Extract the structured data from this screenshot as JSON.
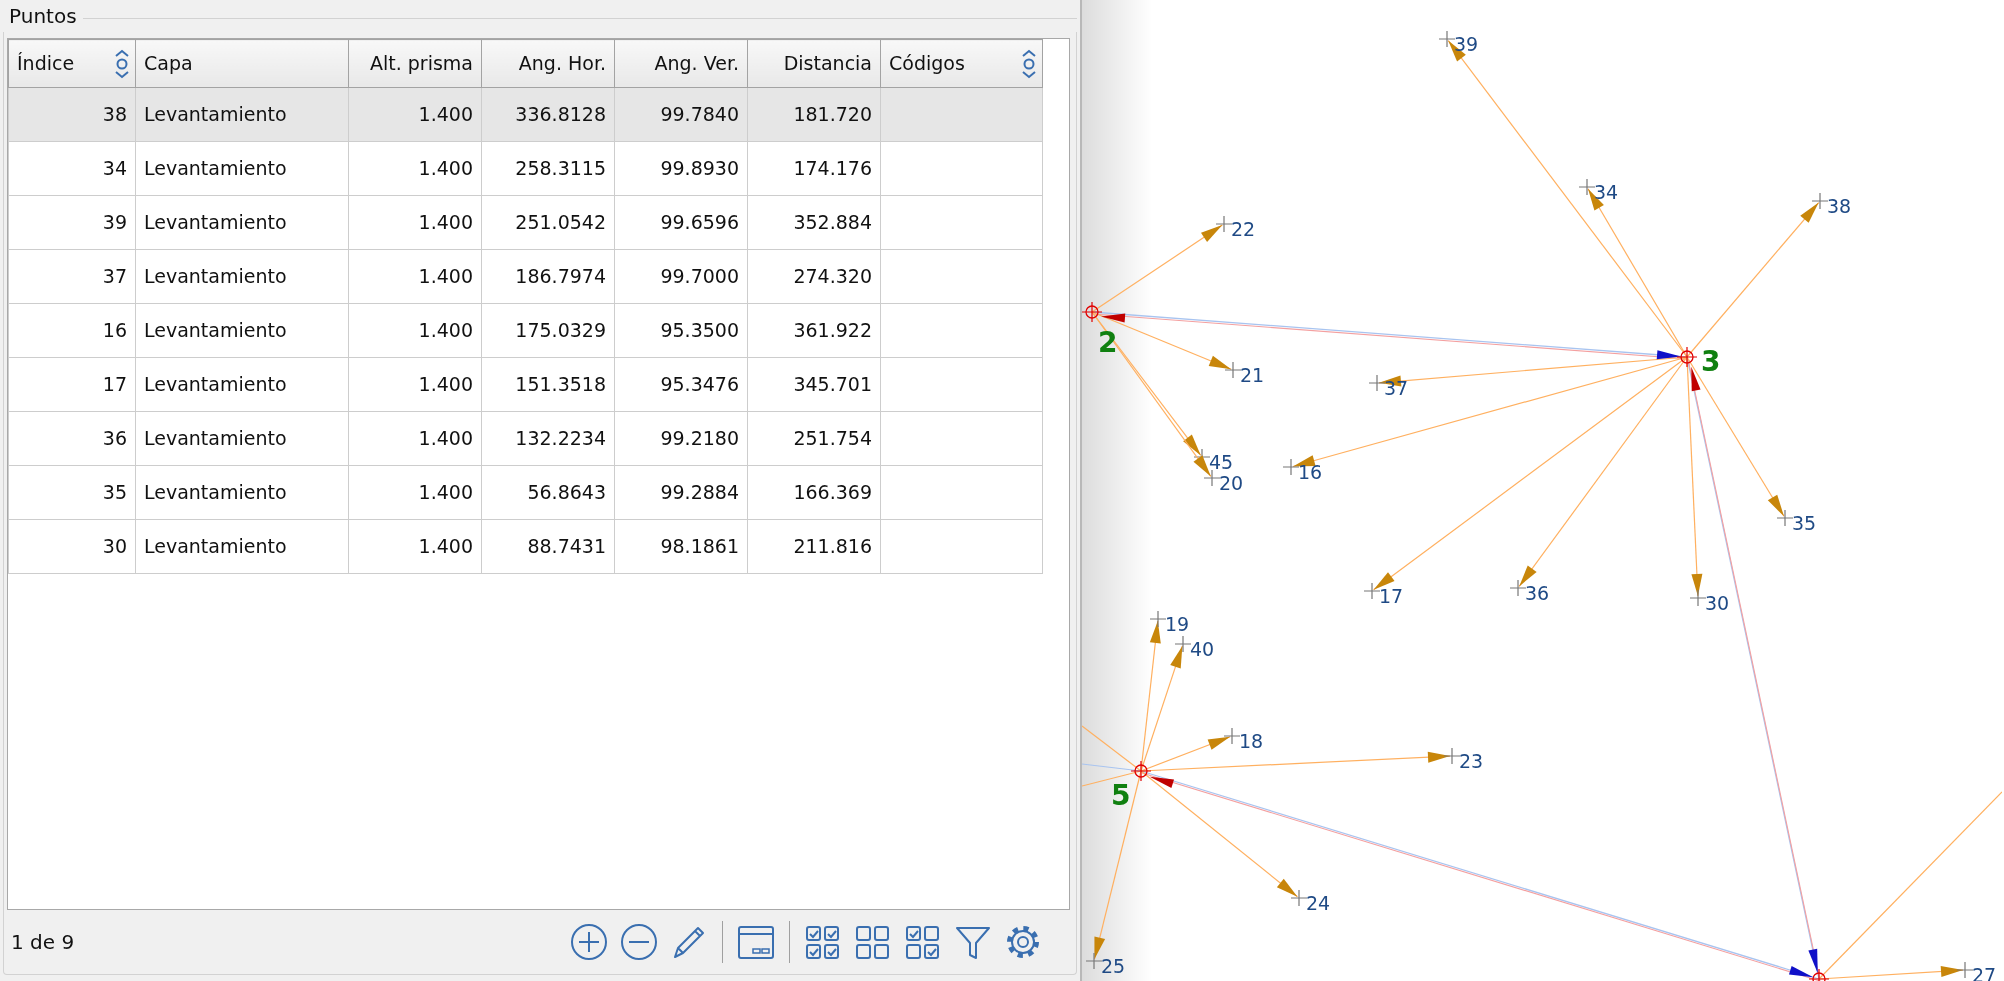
{
  "panel": {
    "title": "Puntos"
  },
  "table": {
    "columns": [
      {
        "label": "Índice",
        "kind": "number",
        "sortable": true
      },
      {
        "label": "Capa",
        "kind": "text",
        "sortable": false
      },
      {
        "label": "Alt. prisma",
        "kind": "number",
        "sortable": false
      },
      {
        "label": "Ang. Hor.",
        "kind": "number",
        "sortable": false
      },
      {
        "label": "Ang. Ver.",
        "kind": "number",
        "sortable": false
      },
      {
        "label": "Distancia",
        "kind": "number",
        "sortable": false
      },
      {
        "label": "Códigos",
        "kind": "text",
        "sortable": true
      }
    ],
    "rows": [
      {
        "selected": true,
        "cells": [
          "38",
          "Levantamiento",
          "1.400",
          "336.8128",
          "99.7840",
          "181.720"
        ]
      },
      {
        "selected": false,
        "cells": [
          "34",
          "Levantamiento",
          "1.400",
          "258.3115",
          "99.8930",
          "174.176"
        ]
      },
      {
        "selected": false,
        "cells": [
          "39",
          "Levantamiento",
          "1.400",
          "251.0542",
          "99.6596",
          "352.884"
        ]
      },
      {
        "selected": false,
        "cells": [
          "37",
          "Levantamiento",
          "1.400",
          "186.7974",
          "99.7000",
          "274.320"
        ]
      },
      {
        "selected": false,
        "cells": [
          "16",
          "Levantamiento",
          "1.400",
          "175.0329",
          "95.3500",
          "361.922"
        ]
      },
      {
        "selected": false,
        "cells": [
          "17",
          "Levantamiento",
          "1.400",
          "151.3518",
          "95.3476",
          "345.701"
        ]
      },
      {
        "selected": false,
        "cells": [
          "36",
          "Levantamiento",
          "1.400",
          "132.2234",
          "99.2180",
          "251.754"
        ]
      },
      {
        "selected": false,
        "cells": [
          "35",
          "Levantamiento",
          "1.400",
          "56.8643",
          "99.2884",
          "166.369"
        ]
      },
      {
        "selected": false,
        "cells": [
          "30",
          "Levantamiento",
          "1.400",
          "88.7431",
          "98.1861",
          "211.816"
        ]
      }
    ]
  },
  "footer": {
    "record": "1 de 9"
  },
  "map": {
    "stations": [
      {
        "label": "2",
        "points": [
          {
            "label": "22"
          },
          {
            "label": "21"
          },
          {
            "label": "45"
          },
          {
            "label": "20"
          }
        ]
      },
      {
        "label": "3",
        "points": [
          {
            "label": "39"
          },
          {
            "label": "34"
          },
          {
            "label": "38"
          },
          {
            "label": "37"
          },
          {
            "label": "16"
          },
          {
            "label": "17"
          },
          {
            "label": "36"
          },
          {
            "label": "30"
          },
          {
            "label": "35"
          }
        ]
      },
      {
        "label": "5",
        "points": [
          {
            "label": "19"
          },
          {
            "label": "40"
          },
          {
            "label": "18"
          },
          {
            "label": "23"
          },
          {
            "label": "24"
          },
          {
            "label": "25"
          }
        ]
      },
      {
        "points": [
          {
            "label": "27"
          }
        ]
      }
    ]
  }
}
